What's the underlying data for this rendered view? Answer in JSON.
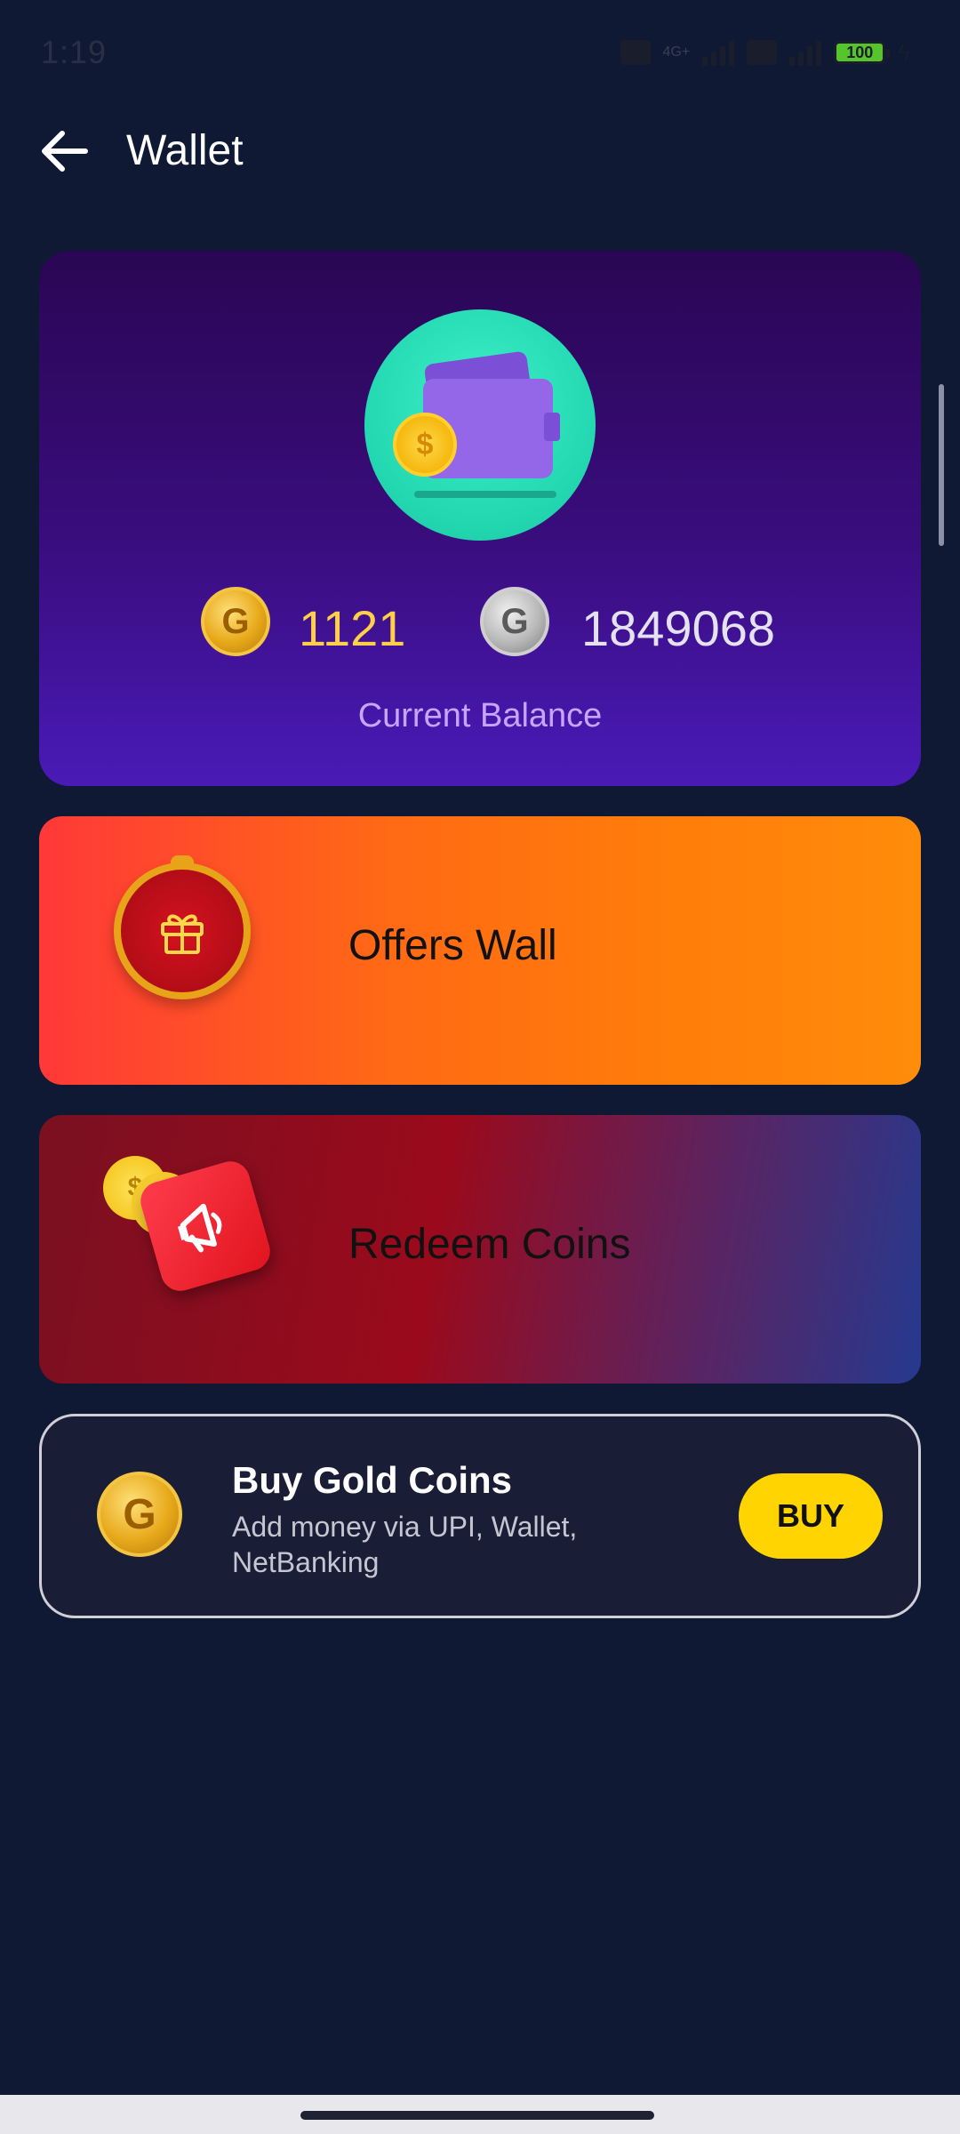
{
  "status_bar": {
    "time": "1:19",
    "network_label": "4G+",
    "battery": "100"
  },
  "header": {
    "title": "Wallet",
    "back_icon": "arrow-left-icon"
  },
  "balance": {
    "gold_coins": "1121",
    "silver_coins": "1849068",
    "label": "Current Balance",
    "gold_coin_letter": "G",
    "silver_coin_letter": "G",
    "wallet_coin_symbol": "$"
  },
  "offers": {
    "label": "Offers Wall",
    "icon": "gift-icon"
  },
  "redeem": {
    "label": "Redeem Coins",
    "icon": "megaphone-icon",
    "coin_symbol": "$"
  },
  "buy": {
    "title": "Buy Gold Coins",
    "subtitle": "Add money via UPI, Wallet, NetBanking",
    "button_label": "BUY",
    "coin_letter": "G"
  },
  "colors": {
    "background": "#0f1934",
    "gold_text": "#ffcf4a",
    "label_purple": "#c8a4ff",
    "buy_button": "#ffd400"
  }
}
